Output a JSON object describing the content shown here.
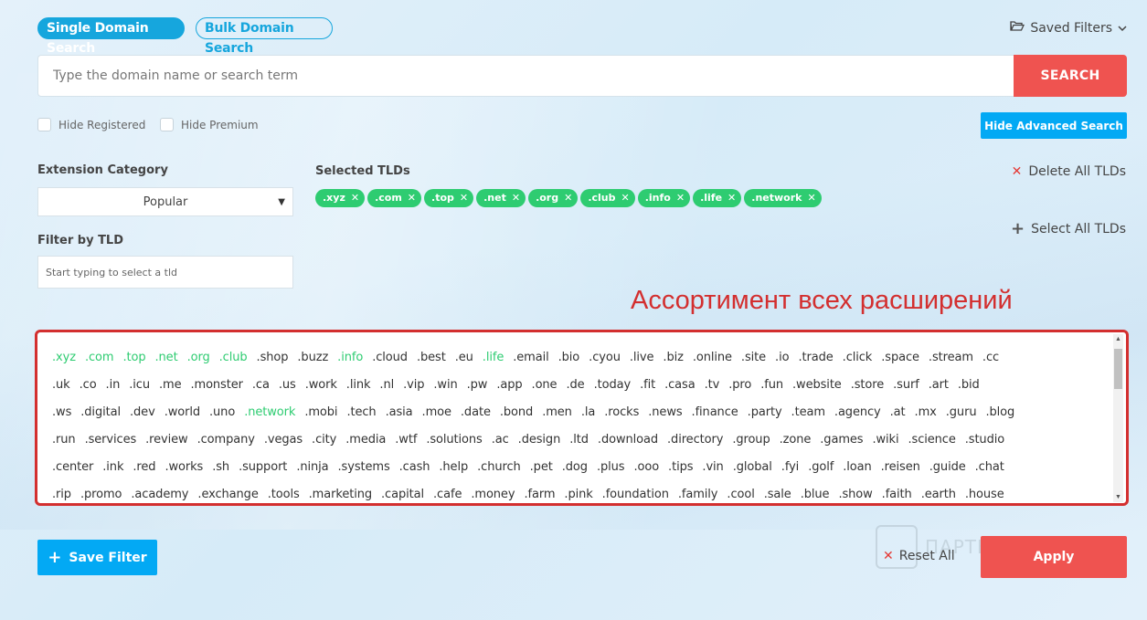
{
  "tabs": {
    "single": "Single Domain Search",
    "bulk": "Bulk Domain Search"
  },
  "saved_filters": {
    "label": "Saved Filters",
    "icon": "folder-open-icon"
  },
  "search": {
    "placeholder": "Type the domain name or search term",
    "value": "",
    "button": "SEARCH"
  },
  "filters": {
    "hide_registered": "Hide Registered",
    "hide_premium": "Hide Premium",
    "advanced_button": "Hide Advanced Search"
  },
  "extension_category": {
    "label": "Extension Category",
    "selected": "Popular"
  },
  "filter_by_tld": {
    "label": "Filter by TLD",
    "placeholder": "Start typing to select a tld"
  },
  "selected_tlds": {
    "label": "Selected TLDs",
    "items": [
      ".xyz",
      ".com",
      ".top",
      ".net",
      ".org",
      ".club",
      ".info",
      ".life",
      ".network"
    ]
  },
  "delete_all": "Delete All TLDs",
  "select_all": "Select All TLDs",
  "annotation": "Ассортимент всех расширений",
  "tld_rows": [
    [
      ".xyz",
      ".com",
      ".top",
      ".net",
      ".org",
      ".club",
      ".shop",
      ".buzz",
      ".info",
      ".cloud",
      ".best",
      ".eu",
      ".life",
      ".email",
      ".bio",
      ".cyou",
      ".live",
      ".biz",
      ".online",
      ".site",
      ".io",
      ".trade",
      ".click",
      ".space",
      ".stream",
      ".cc"
    ],
    [
      ".uk",
      ".co",
      ".in",
      ".icu",
      ".me",
      ".monster",
      ".ca",
      ".us",
      ".work",
      ".link",
      ".nl",
      ".vip",
      ".win",
      ".pw",
      ".app",
      ".one",
      ".de",
      ".today",
      ".fit",
      ".casa",
      ".tv",
      ".pro",
      ".fun",
      ".website",
      ".store",
      ".surf",
      ".art",
      ".bid"
    ],
    [
      ".ws",
      ".digital",
      ".dev",
      ".world",
      ".uno",
      ".network",
      ".mobi",
      ".tech",
      ".asia",
      ".moe",
      ".date",
      ".bond",
      ".men",
      ".la",
      ".rocks",
      ".news",
      ".finance",
      ".party",
      ".team",
      ".agency",
      ".at",
      ".mx",
      ".guru",
      ".blog"
    ],
    [
      ".run",
      ".services",
      ".review",
      ".company",
      ".vegas",
      ".city",
      ".media",
      ".wtf",
      ".solutions",
      ".ac",
      ".design",
      ".ltd",
      ".download",
      ".directory",
      ".group",
      ".zone",
      ".games",
      ".wiki",
      ".science",
      ".studio"
    ],
    [
      ".center",
      ".ink",
      ".red",
      ".works",
      ".sh",
      ".support",
      ".ninja",
      ".systems",
      ".cash",
      ".help",
      ".church",
      ".pet",
      ".dog",
      ".plus",
      ".ooo",
      ".tips",
      ".vin",
      ".global",
      ".fyi",
      ".golf",
      ".loan",
      ".reisen",
      ".guide",
      ".chat"
    ],
    [
      ".rip",
      ".promo",
      ".academy",
      ".exchange",
      ".tools",
      ".marketing",
      ".capital",
      ".cafe",
      ".money",
      ".farm",
      ".pink",
      ".foundation",
      ".family",
      ".cool",
      ".sale",
      ".blue",
      ".show",
      ".faith",
      ".earth",
      ".house"
    ]
  ],
  "save_filter": "Save Filter",
  "reset_all": "Reset All",
  "apply": "Apply",
  "watermark": "ПАРТНЕРКИН",
  "colors": {
    "accent_blue": "#03a9f4",
    "accent_red": "#ef5350",
    "tld_selected": "#2ecc71",
    "annotation_red": "#d32f2f"
  }
}
